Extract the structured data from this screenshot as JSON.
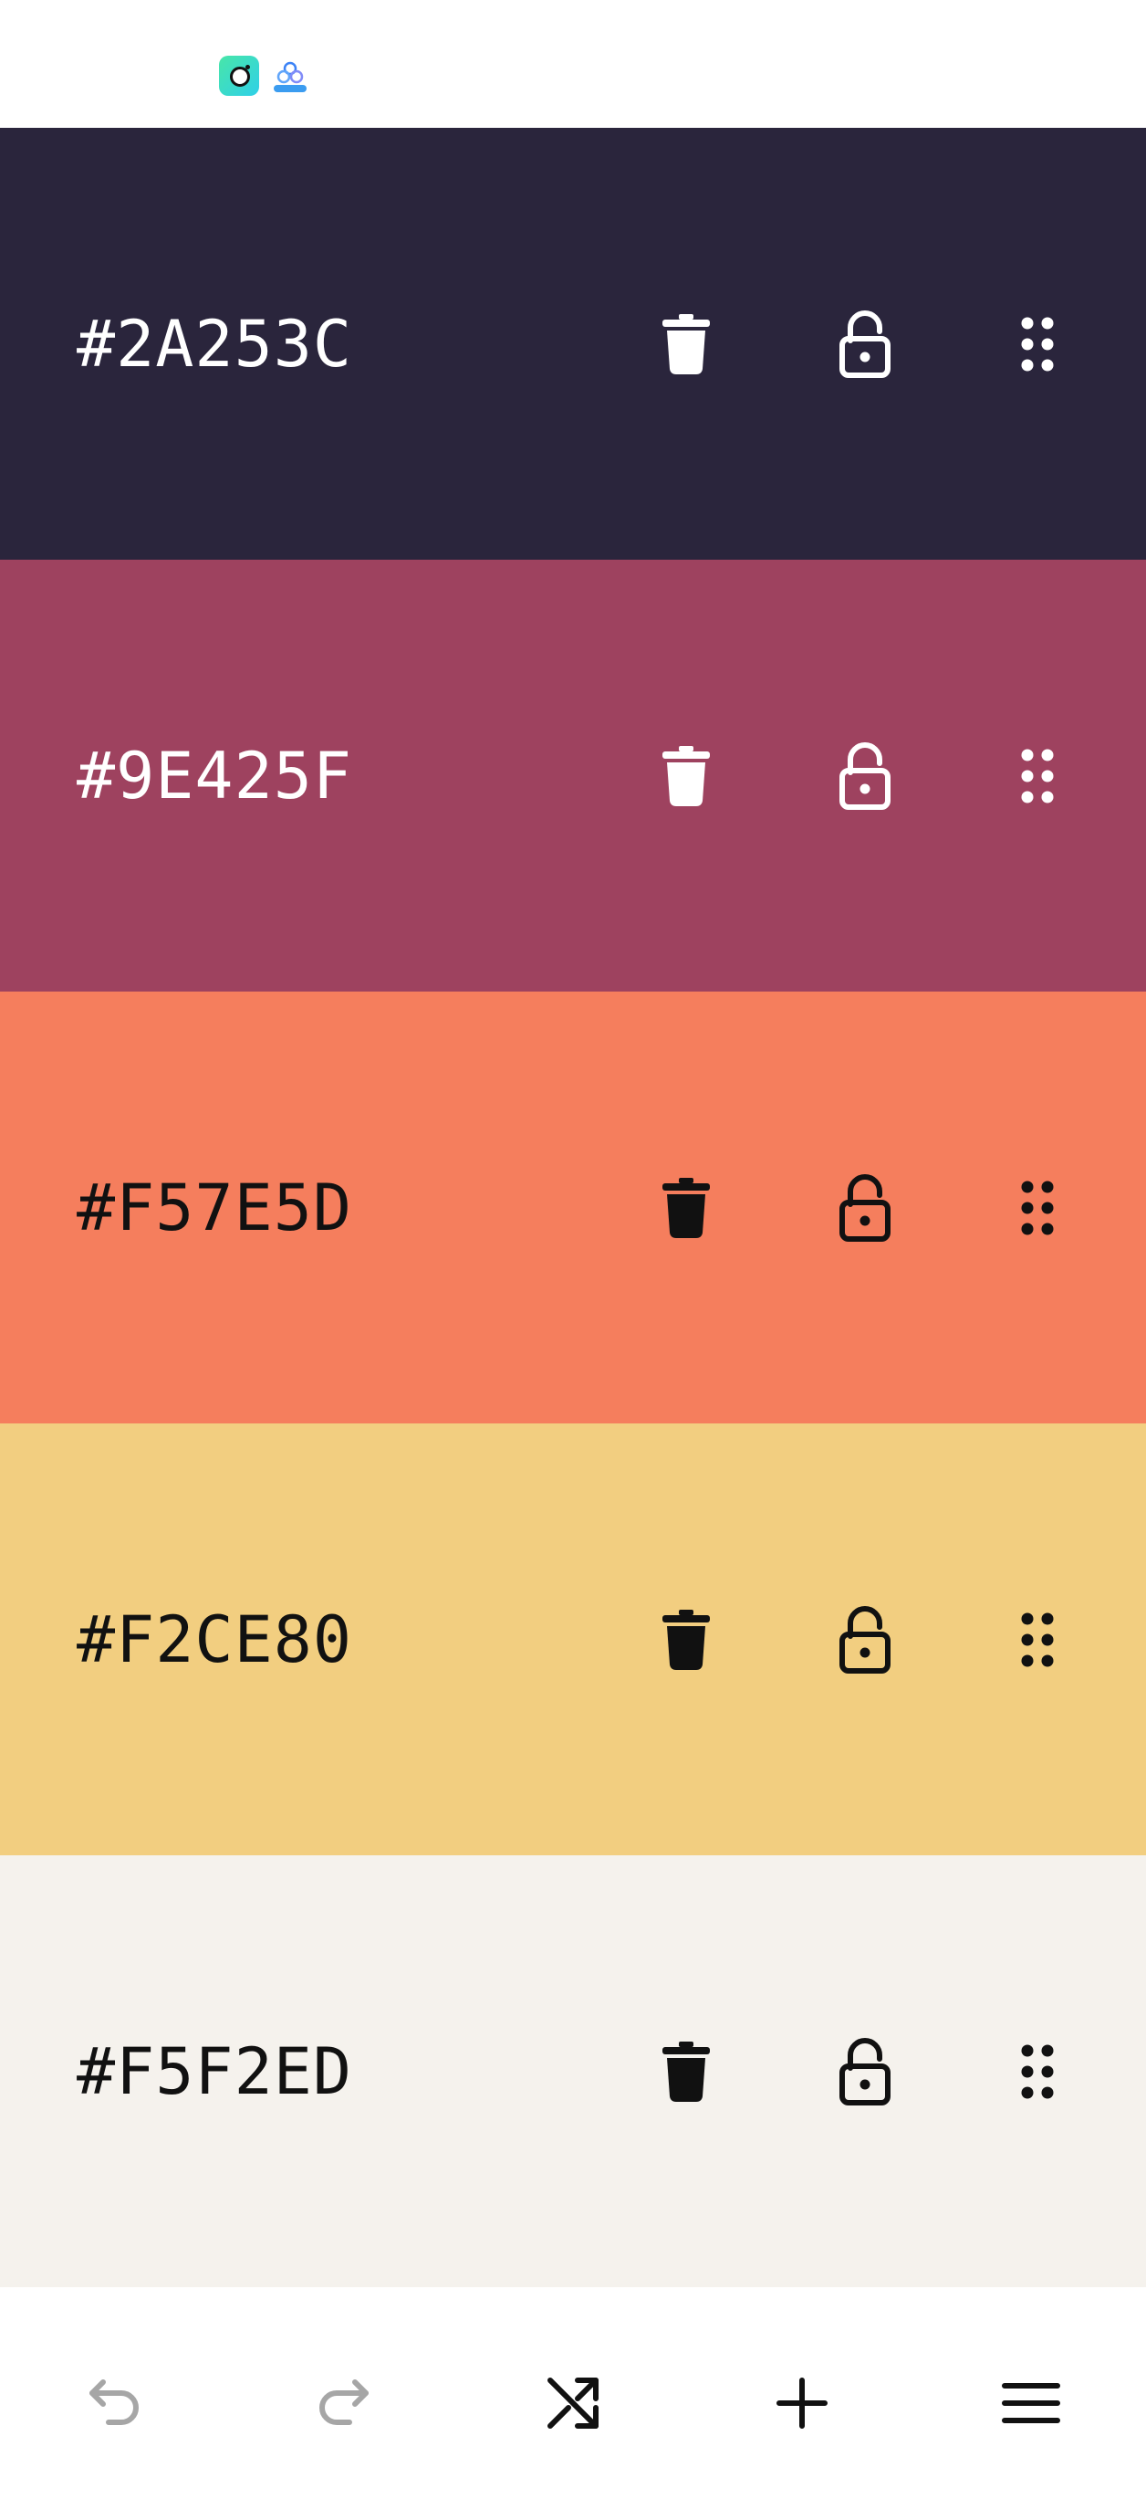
{
  "status_bar": {
    "icons": [
      "camera-app-icon",
      "flow-app-icon"
    ]
  },
  "palette": {
    "swatches": [
      {
        "hex": "#2A253C",
        "color": "#2A253C",
        "fg": "#FFFFFF"
      },
      {
        "hex": "#9E425F",
        "color": "#9E425F",
        "fg": "#FFFFFF"
      },
      {
        "hex": "#F57E5D",
        "color": "#F57E5D",
        "fg": "#111111"
      },
      {
        "hex": "#F2CE80",
        "color": "#F2CE80",
        "fg": "#111111"
      },
      {
        "hex": "#F5F2ED",
        "color": "#F5F2ED",
        "fg": "#111111"
      }
    ],
    "swatch_icons": [
      "trash-icon",
      "unlock-icon",
      "drag-handle-icon"
    ]
  },
  "toolbar": {
    "buttons": [
      {
        "name": "undo",
        "icon": "undo-icon",
        "enabled": false
      },
      {
        "name": "redo",
        "icon": "redo-icon",
        "enabled": false
      },
      {
        "name": "shuffle",
        "icon": "shuffle-icon",
        "enabled": true
      },
      {
        "name": "add",
        "icon": "plus-icon",
        "enabled": true
      },
      {
        "name": "menu",
        "icon": "menu-icon",
        "enabled": true
      }
    ],
    "disabled_color": "#A6A6A6",
    "enabled_color": "#111111"
  }
}
